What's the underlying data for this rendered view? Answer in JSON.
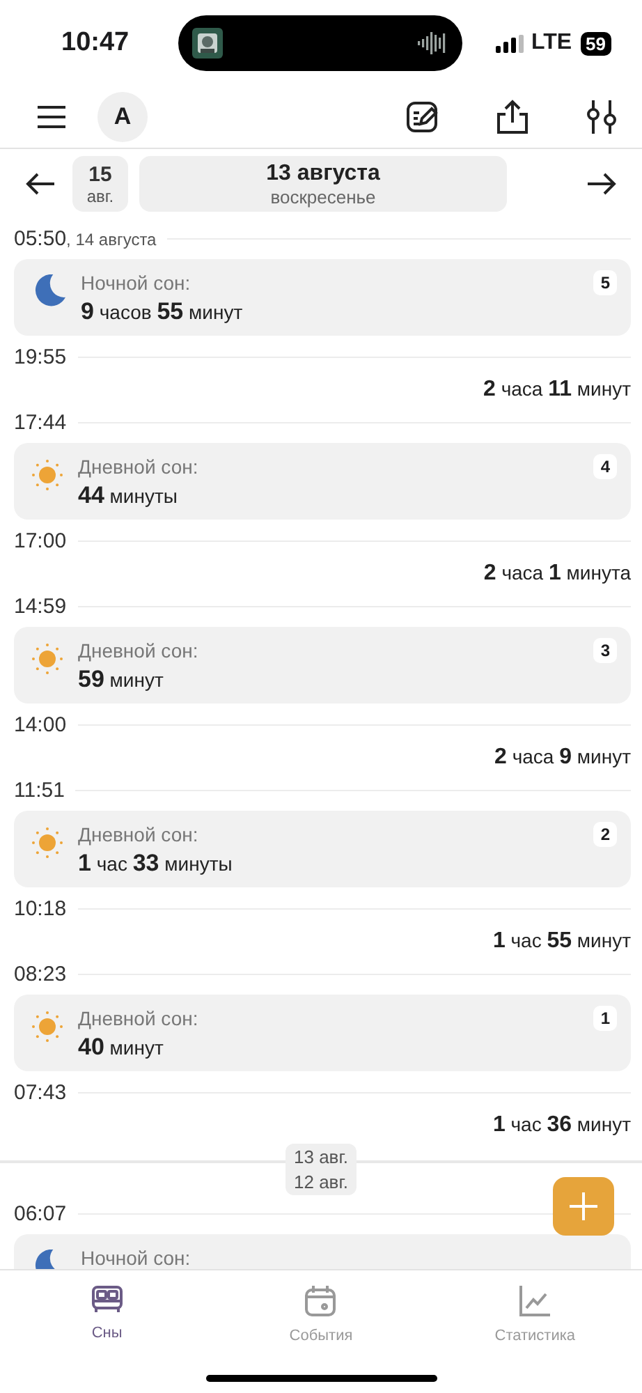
{
  "status_bar": {
    "time": "10:47",
    "network": "LTE",
    "battery": "59"
  },
  "toolbar": {
    "avatar": "A"
  },
  "date_nav": {
    "prev_day": "15",
    "prev_month": "авг.",
    "date": "13 августа",
    "weekday": "воскресенье"
  },
  "timeline": [
    {
      "kind": "time",
      "time": "05:50",
      "note": ", 14 августа"
    },
    {
      "kind": "night",
      "label": "Ночной сон:",
      "duration": "**9** часов **55** минут",
      "number": "5"
    },
    {
      "kind": "time",
      "time": "19:55"
    },
    {
      "kind": "gap",
      "duration": "**2** часа **11** минут"
    },
    {
      "kind": "time",
      "time": "17:44"
    },
    {
      "kind": "day",
      "label": "Дневной сон:",
      "duration": "**44** минуты",
      "number": "4"
    },
    {
      "kind": "time",
      "time": "17:00"
    },
    {
      "kind": "gap",
      "duration": "**2** часа **1** минута"
    },
    {
      "kind": "time",
      "time": "14:59"
    },
    {
      "kind": "day",
      "label": "Дневной сон:",
      "duration": "**59** минут",
      "number": "3"
    },
    {
      "kind": "time",
      "time": "14:00"
    },
    {
      "kind": "gap",
      "duration": "**2** часа **9** минут"
    },
    {
      "kind": "time",
      "time": "11:51"
    },
    {
      "kind": "day",
      "label": "Дневной сон:",
      "duration": "**1** час **33** минуты",
      "number": "2"
    },
    {
      "kind": "time",
      "time": "10:18"
    },
    {
      "kind": "gap",
      "duration": "**1** час **55** минут"
    },
    {
      "kind": "time",
      "time": "08:23"
    },
    {
      "kind": "day",
      "label": "Дневной сон:",
      "duration": "**40** минут",
      "number": "1"
    },
    {
      "kind": "time",
      "time": "07:43"
    },
    {
      "kind": "gap",
      "duration": "**1** час **36** минут"
    },
    {
      "kind": "divider",
      "upper": "13 авг.",
      "lower": "12 авг."
    },
    {
      "kind": "time",
      "time": "06:07"
    },
    {
      "kind": "night",
      "label": "Ночной сон:"
    }
  ],
  "tabs": [
    {
      "label": "Сны",
      "selected": true
    },
    {
      "label": "События",
      "selected": false
    },
    {
      "label": "Статистика",
      "selected": false
    }
  ]
}
